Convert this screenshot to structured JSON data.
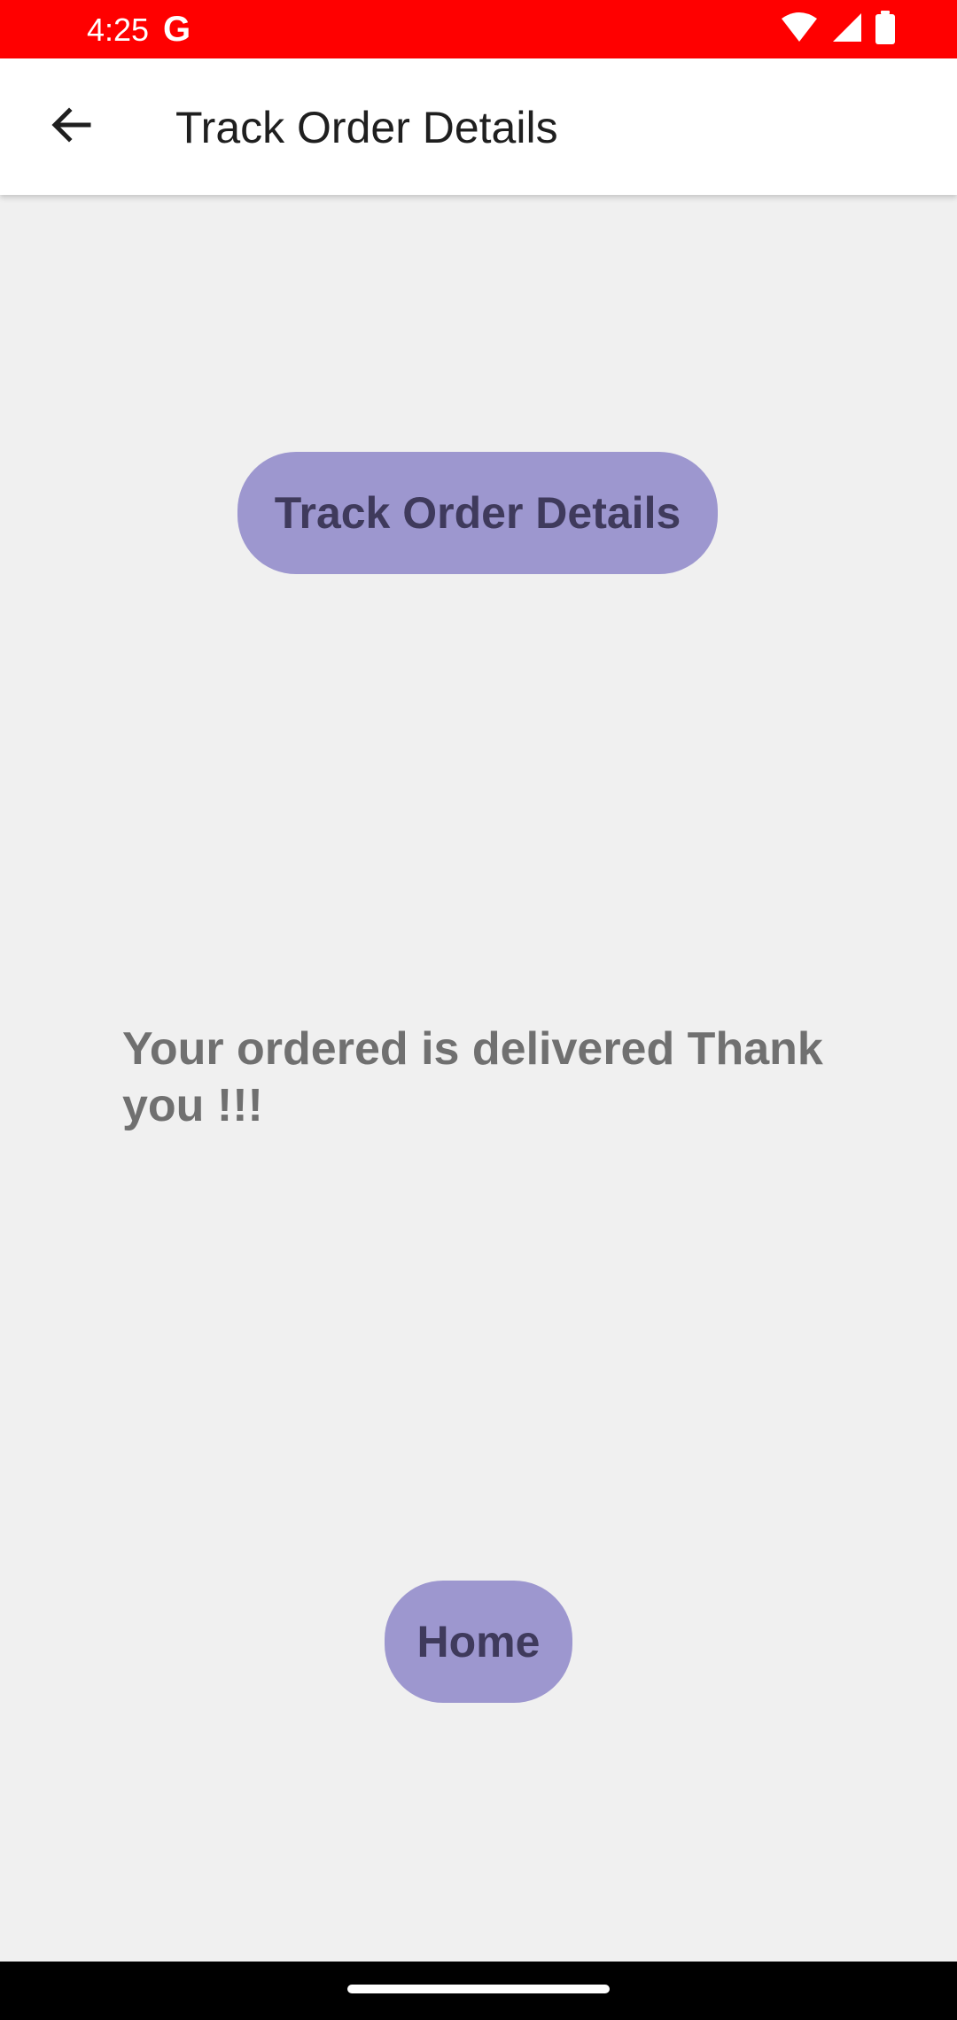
{
  "status_bar": {
    "time": "4:25",
    "g_logo": "G",
    "icons": [
      "wifi-icon",
      "signal-icon",
      "battery-icon"
    ],
    "color": "#ff0000"
  },
  "app_bar": {
    "back_icon": "arrow-left-icon",
    "title": "Track Order Details"
  },
  "main": {
    "track_button_label": "Track Order Details",
    "message": "Your ordered is delivered Thank you !!!",
    "home_button_label": "Home"
  },
  "colors": {
    "button_bg": "#9d97cf",
    "button_text": "#3f3a5c",
    "page_bg": "#f0f0f0"
  }
}
